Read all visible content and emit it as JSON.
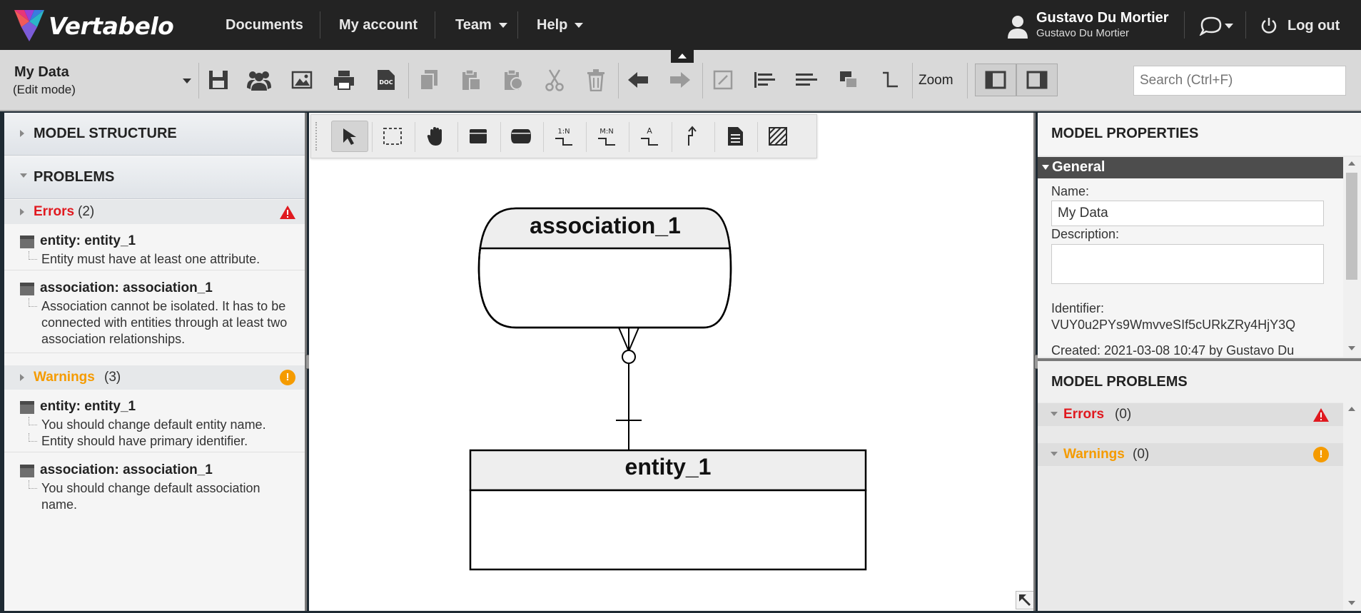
{
  "app": {
    "name": "Vertabelo"
  },
  "nav": {
    "documents": "Documents",
    "my_account": "My account",
    "team": "Team",
    "help": "Help",
    "user_name": "Gustavo Du Mortier",
    "user_sub": "Gustavo Du Mortier",
    "logout": "Log out"
  },
  "toolbar": {
    "doc_title": "My Data",
    "doc_mode": "(Edit mode)",
    "zoom": "Zoom",
    "search_placeholder": "Search (Ctrl+F)",
    "icons": [
      "save-icon",
      "share-users-icon",
      "export-image-icon",
      "print-icon",
      "doc-icon",
      "copy-icon",
      "paste-icon",
      "paste-special-icon",
      "cut-icon",
      "delete-icon",
      "undo-icon",
      "redo-icon",
      "edit-icon",
      "align-icon",
      "distribute-icon",
      "arrange-icon",
      "line-style-icon"
    ]
  },
  "left_panel": {
    "model_structure": "MODEL STRUCTURE",
    "problems": "PROBLEMS",
    "errors_label": "Errors",
    "errors_count": "(2)",
    "warnings_label": "Warnings",
    "warnings_count": "(3)",
    "errors": [
      {
        "title": "entity: entity_1",
        "messages": [
          "Entity must have at least one attribute."
        ]
      },
      {
        "title": "association: association_1",
        "messages": [
          "Association cannot be isolated. It has to be connected with entities through at least two association relationships."
        ]
      }
    ],
    "warnings": [
      {
        "title": "entity: entity_1",
        "messages": [
          "You should change default entity name.",
          "Entity should have primary identifier."
        ]
      },
      {
        "title": "association: association_1",
        "messages": [
          "You should change default association name."
        ]
      }
    ]
  },
  "palette": {
    "tools": [
      "select-tool",
      "marquee-tool",
      "hand-tool",
      "entity-tool",
      "association-tool",
      "one-to-many-tool",
      "many-to-many-tool",
      "inheritance-tool",
      "relationship-tool",
      "note-tool",
      "area-tool"
    ],
    "one_n": "1:N",
    "m_n": "M:N"
  },
  "diagram": {
    "association_name": "association_1",
    "entity_name": "entity_1"
  },
  "right_panel": {
    "model_properties": "MODEL PROPERTIES",
    "general": "General",
    "name_label": "Name:",
    "name_value": "My Data",
    "description_label": "Description:",
    "identifier_label": "Identifier:",
    "identifier_value": "VUY0u2PYs9WmvveSIf5cURkZRy4HjY3Q",
    "created": "Created: 2021-03-08 10:47 by Gustavo Du",
    "model_problems": "MODEL PROBLEMS",
    "errors_label": "Errors",
    "errors_count": "(0)",
    "warnings_label": "Warnings",
    "warnings_count": "(0)"
  },
  "colors": {
    "error": "#e0191f",
    "warning": "#f59b00",
    "topbar": "#232323"
  }
}
